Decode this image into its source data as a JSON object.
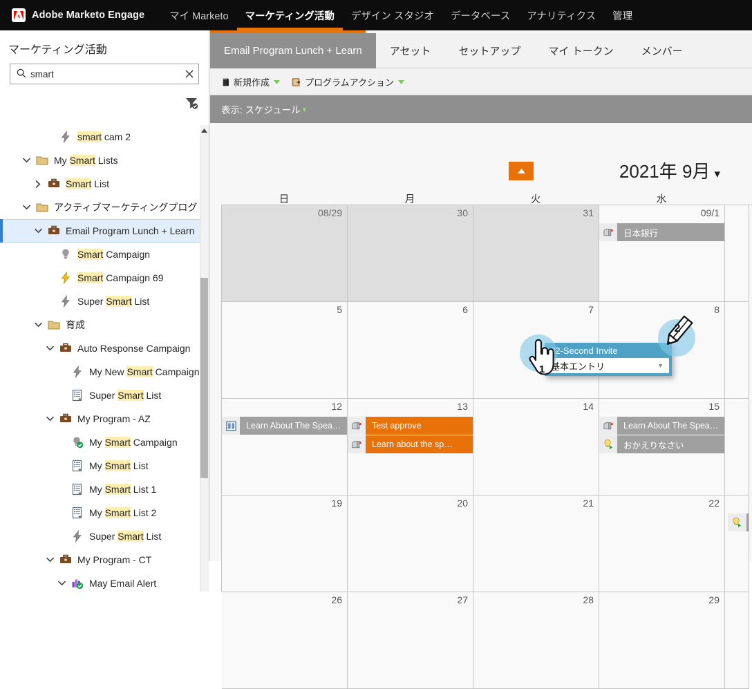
{
  "topnav": {
    "brand": "Adobe Marketo Engage",
    "brand_logo_icon": "adobe-logo-icon",
    "items": [
      {
        "label": "マイ Marketo",
        "active": false
      },
      {
        "label": "マーケティング活動",
        "active": true
      },
      {
        "label": "デザイン スタジオ",
        "active": false
      },
      {
        "label": "データベース",
        "active": false
      },
      {
        "label": "アナリティクス",
        "active": false
      },
      {
        "label": "管理",
        "active": false
      }
    ]
  },
  "sidebar": {
    "title": "マーケティング活動",
    "search": {
      "value": "smart",
      "placeholder": "",
      "search_icon": "search-icon",
      "clear_icon": "close-icon"
    },
    "filter_icon": "filter-icon",
    "tree": [
      {
        "indent": 3,
        "twisty": "none",
        "icon": "lightning-gray-icon",
        "label": "smart cam 2",
        "highlight": "smart",
        "selected": false
      },
      {
        "indent": 1,
        "twisty": "down",
        "icon": "folder-icon",
        "label": "My Smart Lists",
        "highlight": "Smart",
        "selected": false
      },
      {
        "indent": 2,
        "twisty": "right",
        "icon": "briefcase-icon",
        "label": "Smart List",
        "highlight": "Smart",
        "selected": false
      },
      {
        "indent": 1,
        "twisty": "down",
        "icon": "folder-icon",
        "label": "アクティブマーケティングプログ",
        "highlight": "",
        "selected": false
      },
      {
        "indent": 2,
        "twisty": "down",
        "icon": "briefcase-icon",
        "label": "Email Program Lunch + Learn",
        "highlight": "",
        "selected": true
      },
      {
        "indent": 3,
        "twisty": "none",
        "icon": "bulb-gray-icon",
        "label": "Smart Campaign",
        "highlight": "Smart",
        "selected": false
      },
      {
        "indent": 3,
        "twisty": "none",
        "icon": "lightning-yellow-icon",
        "label": "Smart Campaign 69",
        "highlight": "Smart",
        "selected": false
      },
      {
        "indent": 3,
        "twisty": "none",
        "icon": "lightning-gray-icon",
        "label": "Super Smart List",
        "highlight": "Smart",
        "selected": false
      },
      {
        "indent": 2,
        "twisty": "down",
        "icon": "folder-icon",
        "label": "育成",
        "highlight": "",
        "selected": false
      },
      {
        "indent": 3,
        "twisty": "down",
        "icon": "briefcase-icon",
        "label": "Auto Response Campaign",
        "highlight": "",
        "selected": false
      },
      {
        "indent": 4,
        "twisty": "none",
        "icon": "lightning-gray-icon",
        "label": "My New Smart Campaign",
        "highlight": "Smart",
        "selected": false
      },
      {
        "indent": 4,
        "twisty": "none",
        "icon": "list-icon",
        "label": "Super Smart List",
        "highlight": "Smart",
        "selected": false
      },
      {
        "indent": 3,
        "twisty": "down",
        "icon": "briefcase-icon",
        "label": "My Program - AZ",
        "highlight": "",
        "selected": false
      },
      {
        "indent": 4,
        "twisty": "none",
        "icon": "bulb-check-icon",
        "label": "My Smart Campaign",
        "highlight": "Smart",
        "selected": false
      },
      {
        "indent": 4,
        "twisty": "none",
        "icon": "list-icon",
        "label": "My Smart List",
        "highlight": "Smart",
        "selected": false
      },
      {
        "indent": 4,
        "twisty": "none",
        "icon": "list-icon",
        "label": "My Smart List 1",
        "highlight": "Smart",
        "selected": false
      },
      {
        "indent": 4,
        "twisty": "none",
        "icon": "list-icon",
        "label": "My Smart List 2",
        "highlight": "Smart",
        "selected": false
      },
      {
        "indent": 4,
        "twisty": "none",
        "icon": "lightning-gray-icon",
        "label": "Super Smart List",
        "highlight": "Smart",
        "selected": false
      },
      {
        "indent": 3,
        "twisty": "down",
        "icon": "briefcase-icon",
        "label": "My Program - CT",
        "highlight": "",
        "selected": false
      },
      {
        "indent": 4,
        "twisty": "down",
        "icon": "program-check-icon",
        "label": "May Email Alert",
        "highlight": "",
        "selected": false
      }
    ],
    "scroll_up_icon": "scroll-up-arrow-icon"
  },
  "program": {
    "tabs": [
      {
        "label": "Email Program Lunch + Learn",
        "active": true
      },
      {
        "label": "アセット",
        "active": false
      },
      {
        "label": "セットアップ",
        "active": false
      },
      {
        "label": "マイ トークン",
        "active": false
      },
      {
        "label": "メンバー",
        "active": false
      }
    ],
    "toolbar": [
      {
        "label": "新規作成",
        "icon": "new-document-icon",
        "caret": "▾"
      },
      {
        "label": "プログラムアクション",
        "icon": "program-action-icon",
        "caret": "▾"
      }
    ],
    "viewbar": {
      "label": "表示: スケジュール",
      "caret": "▾"
    }
  },
  "calendar": {
    "collapse_icon": "chevron-up-icon",
    "month_label": "2021年 9月",
    "month_caret": "▾",
    "day_headers": [
      "日",
      "月",
      "火",
      "水"
    ],
    "weeks": [
      {
        "days": [
          {
            "num": "08/29",
            "other_month": true,
            "events": []
          },
          {
            "num": "30",
            "other_month": true,
            "events": []
          },
          {
            "num": "31",
            "other_month": true,
            "events": []
          },
          {
            "num": "09/1",
            "other_month": false,
            "events": [
              {
                "label": "日本銀行",
                "color": "gray",
                "icon": "mailbox-icon"
              }
            ]
          }
        ],
        "partial": {
          "num": "",
          "events": []
        }
      },
      {
        "days": [
          {
            "num": "5",
            "other_month": false,
            "events": []
          },
          {
            "num": "6",
            "other_month": false,
            "events": []
          },
          {
            "num": "7",
            "other_month": false,
            "events": []
          },
          {
            "num": "8",
            "other_month": false,
            "events": []
          }
        ],
        "partial": {
          "num": "",
          "events": []
        }
      },
      {
        "days": [
          {
            "num": "12",
            "other_month": false,
            "events": [
              {
                "label": "Learn About The Spea…",
                "color": "gray",
                "icon": "columns-icon"
              }
            ]
          },
          {
            "num": "13",
            "other_month": false,
            "events": [
              {
                "label": "Test approve",
                "color": "orange",
                "icon": "mailbox-icon"
              },
              {
                "label": "Learn about the sp…",
                "color": "orange",
                "icon": "mailbox-icon"
              }
            ]
          },
          {
            "num": "14",
            "other_month": false,
            "events": []
          },
          {
            "num": "15",
            "other_month": false,
            "events": [
              {
                "label": "Learn About The Spea…",
                "color": "gray",
                "icon": "mailbox-icon"
              },
              {
                "label": "おかえりなさい",
                "color": "gray",
                "icon": "bulb-run-icon"
              }
            ]
          }
        ],
        "partial": {
          "num": "",
          "events": []
        }
      },
      {
        "days": [
          {
            "num": "19",
            "other_month": false,
            "events": []
          },
          {
            "num": "20",
            "other_month": false,
            "events": []
          },
          {
            "num": "21",
            "other_month": false,
            "events": []
          },
          {
            "num": "22",
            "other_month": false,
            "events": []
          }
        ],
        "partial": {
          "num": "",
          "edge_icon": "bulb-run-icon",
          "events": []
        }
      },
      {
        "days": [
          {
            "num": "26",
            "other_month": false,
            "events": []
          },
          {
            "num": "27",
            "other_month": false,
            "events": []
          },
          {
            "num": "28",
            "other_month": false,
            "events": []
          },
          {
            "num": "29",
            "other_month": false,
            "events": []
          }
        ],
        "partial": {
          "num": "",
          "events": []
        }
      }
    ]
  },
  "drag_overlay": {
    "title": "02-Second Invite",
    "select_value": "基本エントリ",
    "select_caret": "▾",
    "hotspot_1_label": "1",
    "hotspot_2_label": "2",
    "cursor_icon": "hand-pointer-icon",
    "pencil_icon": "pencil-icon"
  },
  "colors": {
    "accent_orange": "#e8710a",
    "topnav_bg": "#0d0d0d",
    "selected_row": "#e2eefb",
    "event_gray": "#a0a0a0",
    "drag_blue": "#4fa2c6",
    "highlight_yellow": "#fbeeae"
  }
}
